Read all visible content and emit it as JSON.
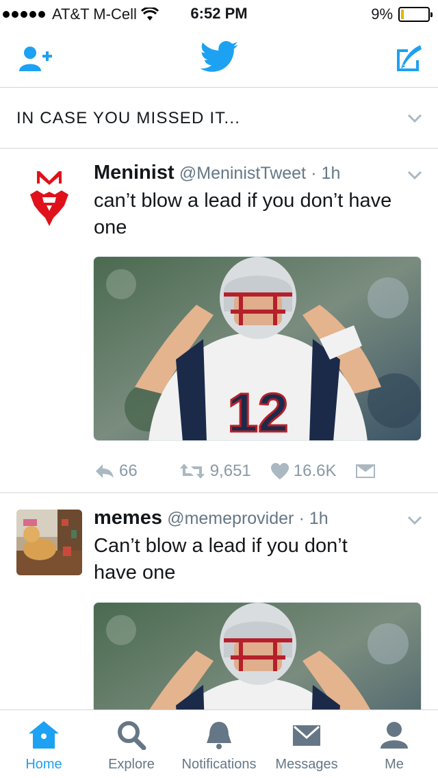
{
  "status_bar": {
    "carrier": "AT&T M-Cell",
    "time": "6:52 PM",
    "battery": "9%",
    "battery_level": 0.09
  },
  "nav": {
    "add_user_icon": "add-user-icon",
    "logo_icon": "twitter-bird-icon",
    "compose_icon": "compose-tweet-icon",
    "accent": "#1da1f2"
  },
  "section": {
    "title": "IN CASE YOU MISSED IT..."
  },
  "tweets": [
    {
      "name": "Meninist",
      "handle": "@MeninistTweet",
      "time": "· 1h",
      "text": "can’t blow a lead if you don’t have one",
      "replies": "66",
      "retweets": "9,651",
      "likes": "16.6K"
    },
    {
      "name": "memes",
      "handle": "@memeprovider",
      "time": "· 1h",
      "text": "Can’t blow a lead if you don’t have one"
    }
  ],
  "tabs": [
    {
      "label": "Home",
      "icon": "home-icon",
      "active": true
    },
    {
      "label": "Explore",
      "icon": "search-icon",
      "active": false
    },
    {
      "label": "Notifications",
      "icon": "bell-icon",
      "active": false
    },
    {
      "label": "Messages",
      "icon": "envelope-icon",
      "active": false
    },
    {
      "label": "Me",
      "icon": "person-icon",
      "active": false
    }
  ]
}
